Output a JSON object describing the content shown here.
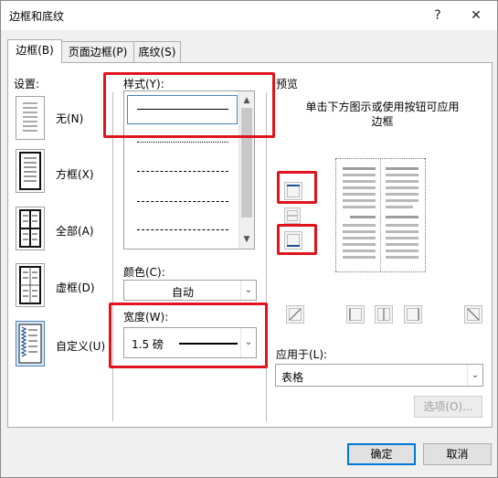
{
  "window": {
    "title": "边框和底纹",
    "help_icon": "?",
    "close_icon": "✕"
  },
  "tabs": [
    {
      "label": "边框(B)",
      "active": true
    },
    {
      "label": "页面边框(P)",
      "active": false
    },
    {
      "label": "底纹(S)",
      "active": false
    }
  ],
  "settings": {
    "label": "设置:",
    "items": [
      {
        "label": "无(N)",
        "icon": "no-border-icon"
      },
      {
        "label": "方框(X)",
        "icon": "box-border-icon"
      },
      {
        "label": "全部(A)",
        "icon": "all-borders-icon"
      },
      {
        "label": "虚框(D)",
        "icon": "grid-border-icon"
      },
      {
        "label": "自定义(U)",
        "icon": "custom-border-icon",
        "selected": true
      }
    ]
  },
  "style": {
    "label": "样式(Y):"
  },
  "color": {
    "label": "颜色(C):",
    "value": "自动"
  },
  "width": {
    "label": "宽度(W):",
    "value": "1.5 磅"
  },
  "preview": {
    "label": "预览",
    "hint": "单击下方图示或使用按钮可应用边框"
  },
  "apply_to": {
    "label": "应用于(L):",
    "value": "表格"
  },
  "buttons": {
    "options": "选项(O)...",
    "ok": "确定",
    "cancel": "取消"
  },
  "colors": {
    "highlight": "#e0141e",
    "accent": "#0078d7"
  }
}
